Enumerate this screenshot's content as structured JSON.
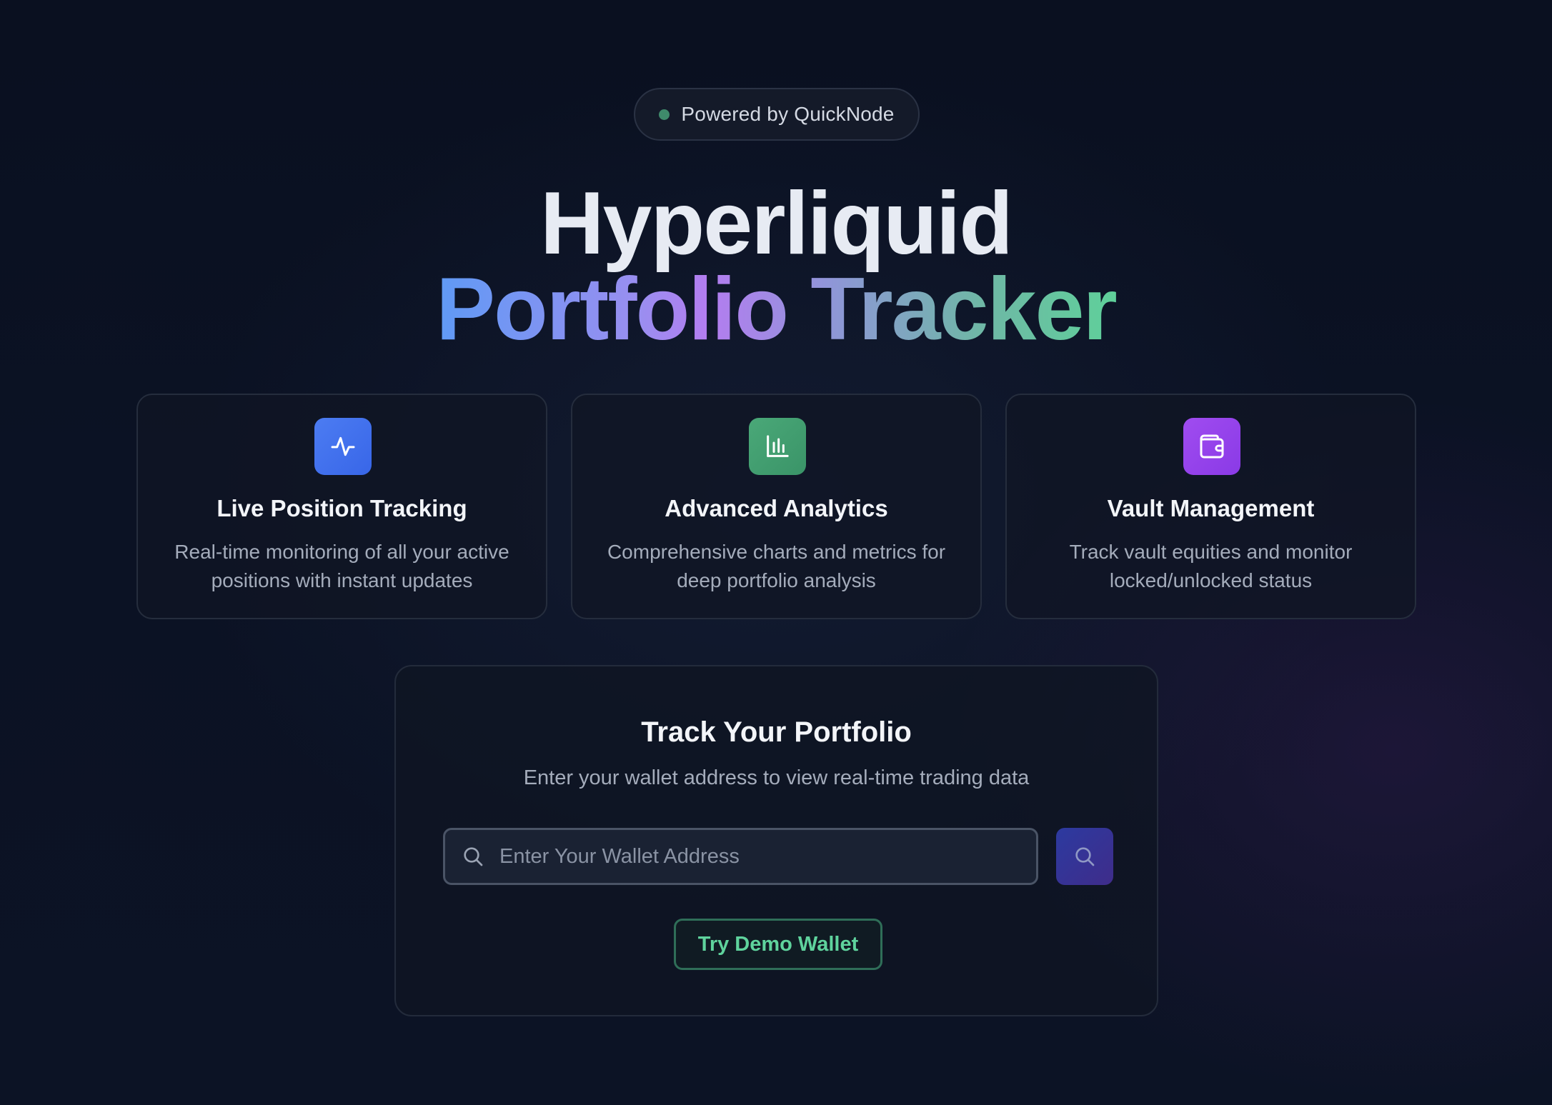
{
  "badge": {
    "text": "Powered by QuickNode",
    "dot_color": "#3f8a6b"
  },
  "hero": {
    "title_line1": "Hyperliquid",
    "title_line2": "Portfolio Tracker"
  },
  "features": [
    {
      "icon": "activity-icon",
      "icon_color": "#4c7cf2",
      "title": "Live Position Tracking",
      "description": "Real-time monitoring of all your active positions with instant updates"
    },
    {
      "icon": "bar-chart-icon",
      "icon_color": "#4aa878",
      "title": "Advanced Analytics",
      "description": "Comprehensive charts and metrics for deep portfolio analysis"
    },
    {
      "icon": "wallet-icon",
      "icon_color": "#a04cf0",
      "title": "Vault Management",
      "description": "Track vault equities and monitor locked/unlocked status"
    }
  ],
  "tracker": {
    "title": "Track Your Portfolio",
    "subtitle": "Enter your wallet address to view real-time trading data",
    "search_value": "",
    "search_placeholder": "Enter Your Wallet Address",
    "demo_button_label": "Try Demo Wallet",
    "accent_color": "#5fd39d"
  }
}
